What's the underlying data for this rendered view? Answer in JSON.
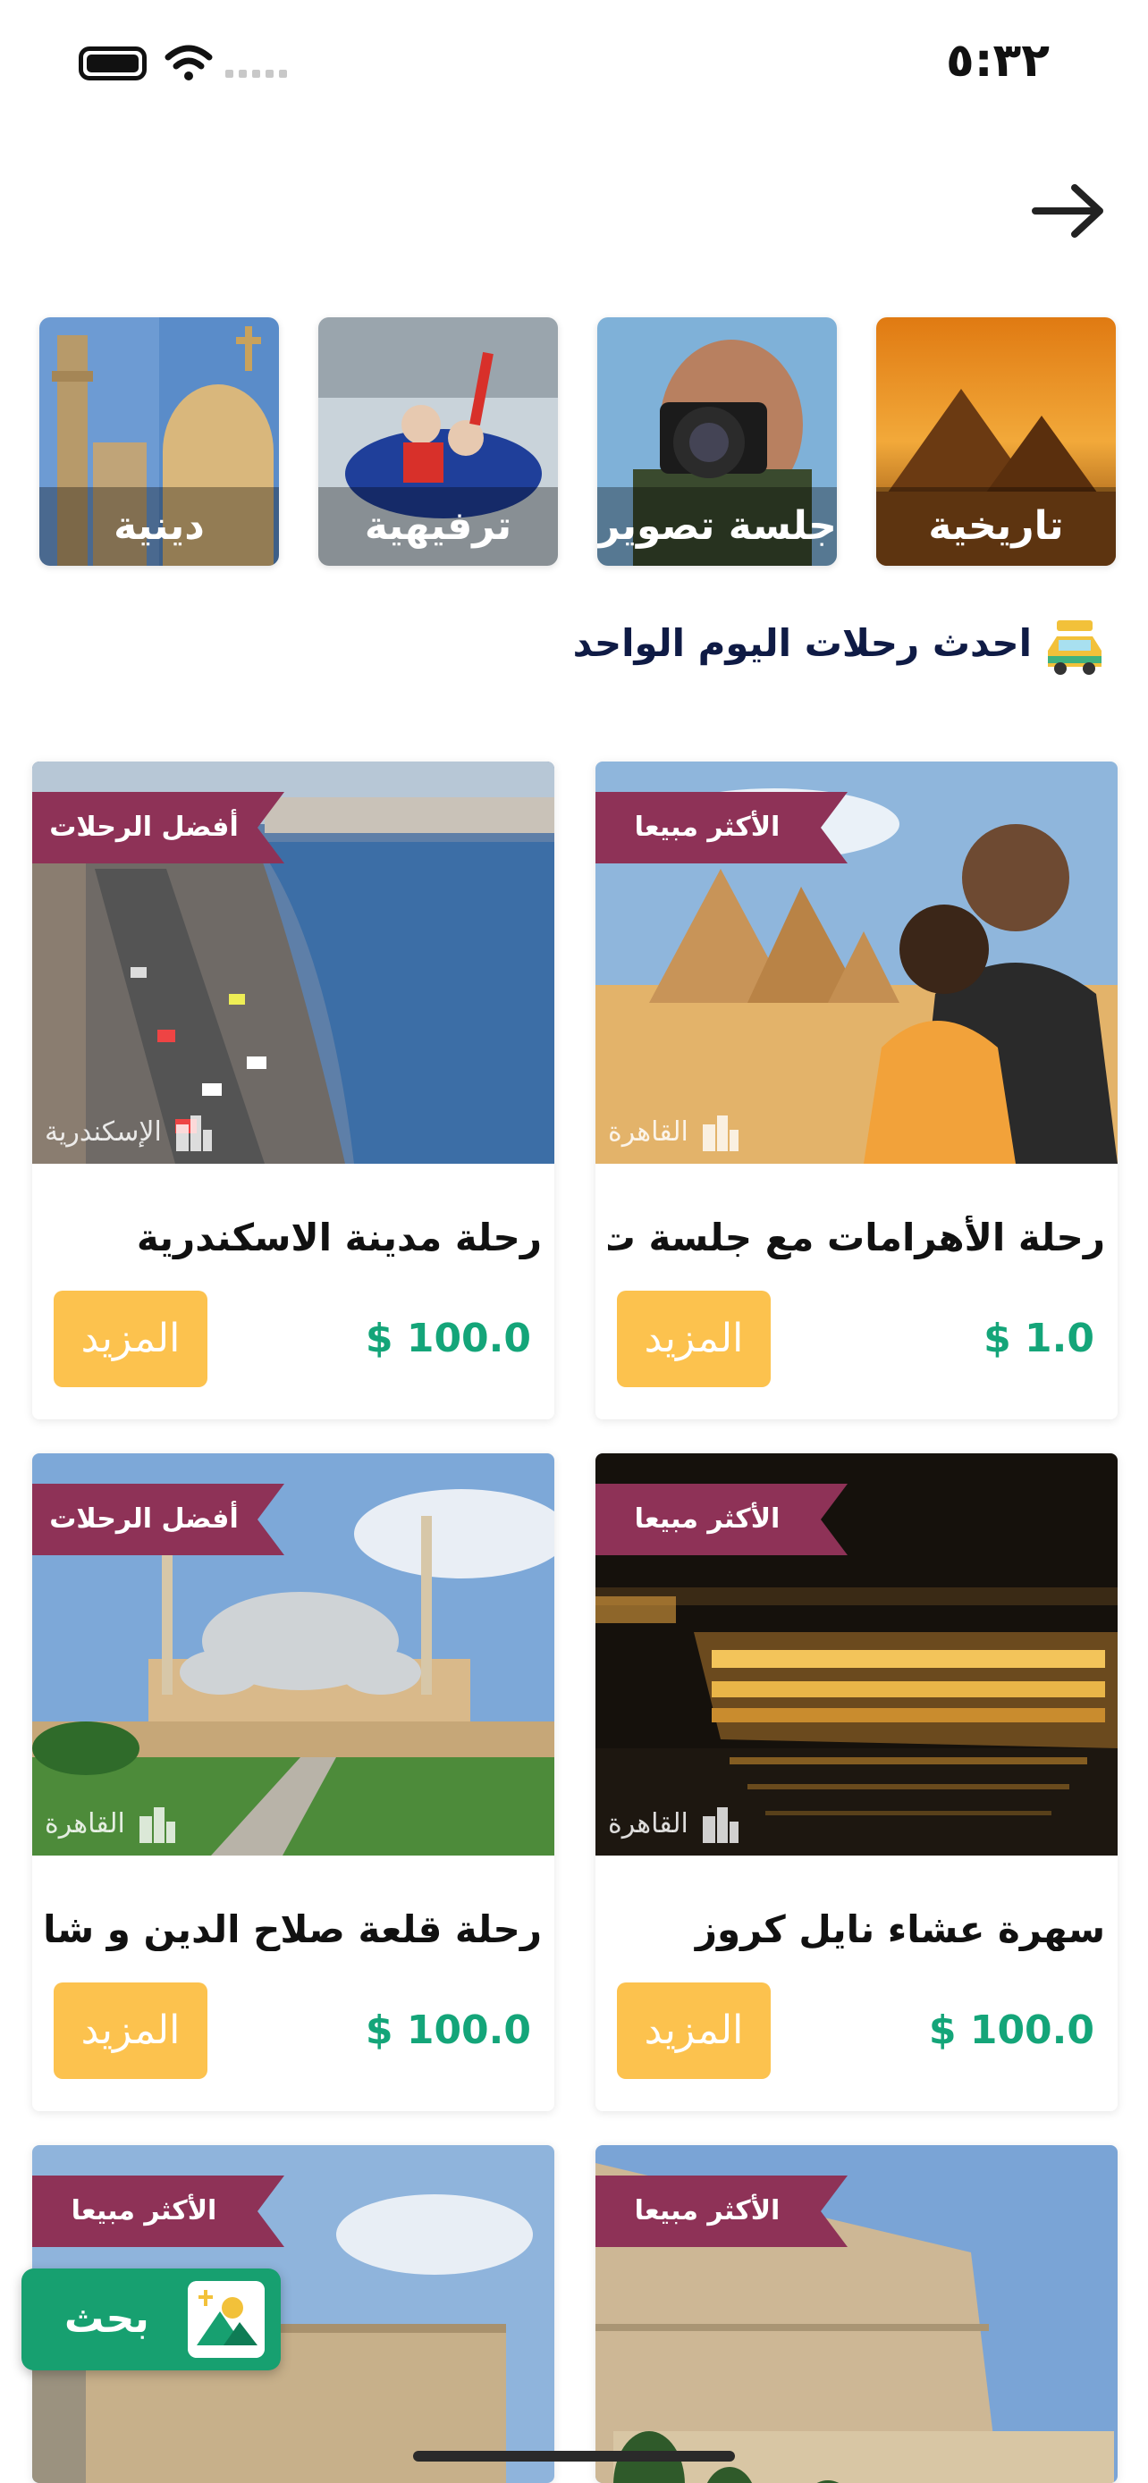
{
  "status": {
    "time": "٥:٣٢"
  },
  "categories": [
    {
      "label": "تاريخية"
    },
    {
      "label": "جلسة تصوير"
    },
    {
      "label": "ترفيهية"
    },
    {
      "label": "دينية"
    }
  ],
  "section": {
    "title": "احدث رحلات اليوم الواحد"
  },
  "cards": [
    {
      "badge": "الأكثر مبيعا",
      "location": "القاهرة",
      "title": "رحلة الأهرامات مع جلسة ت...",
      "more": "المزيد",
      "price": "$ 1.0"
    },
    {
      "badge": "أفضل الرحلات",
      "location": "الإسكندرية",
      "title": "رحلة مدينة الاسكندرية",
      "more": "المزيد",
      "price": "$ 100.0"
    },
    {
      "badge": "الأكثر مبيعا",
      "location": "القاهرة",
      "title": "سهرة عشاء نايل كروز",
      "more": "المزيد",
      "price": "$ 100.0"
    },
    {
      "badge": "أفضل الرحلات",
      "location": "القاهرة",
      "title": "رحلة قلعة صلاح الدين و شا...",
      "more": "المزيد",
      "price": "$ 100.0"
    },
    {
      "badge": "الأكثر مبيعا"
    },
    {
      "badge": "الأكثر مبيعا"
    }
  ],
  "search_button": {
    "label": "بحث"
  },
  "colors": {
    "ribbon": "#8e3257",
    "accent_green": "#17a070",
    "more_button": "#fcc24e",
    "price": "#14a579",
    "heading": "#0f1b45"
  }
}
